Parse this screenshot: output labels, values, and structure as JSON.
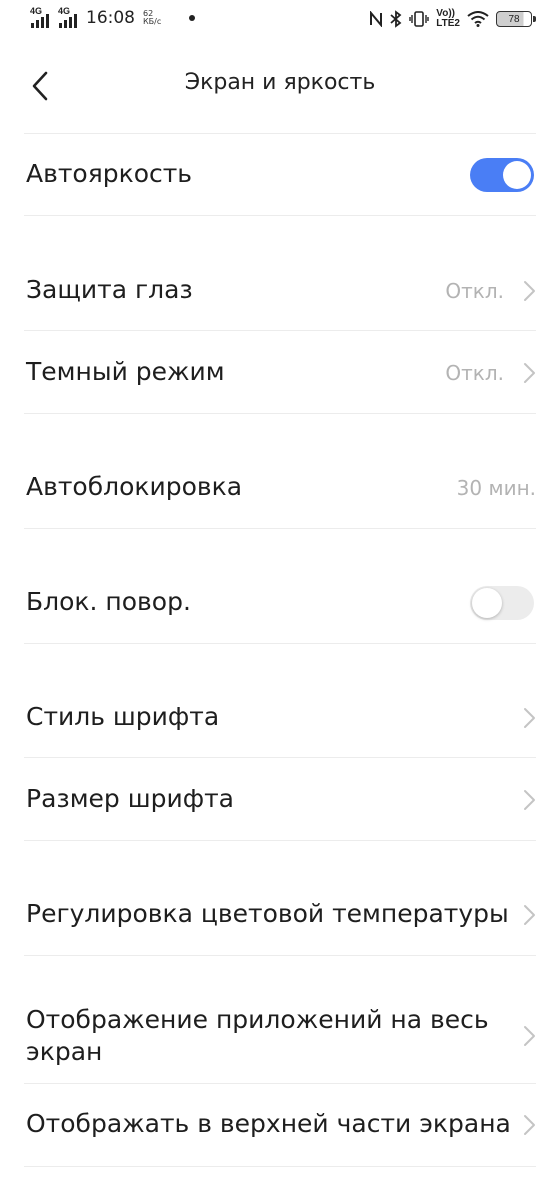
{
  "status_bar": {
    "sim1_tag": "4G",
    "sim2_tag": "4G",
    "time": "16:08",
    "speed_value": "62",
    "speed_unit": "КБ/с",
    "volte_top": "Vo))",
    "volte_bottom": "LTE2",
    "battery": "78"
  },
  "header": {
    "title": "Экран и яркость"
  },
  "rows": {
    "auto_brightness": {
      "label": "Автояркость",
      "toggle_on": true
    },
    "eye_protection": {
      "label": "Защита глаз",
      "value": "Откл."
    },
    "dark_mode": {
      "label": "Темный режим",
      "value": "Откл."
    },
    "auto_lock": {
      "label": "Автоблокировка",
      "value": "30 мин."
    },
    "rotation_lock": {
      "label": "Блок. повор.",
      "toggle_on": false
    },
    "font_style": {
      "label": "Стиль шрифта"
    },
    "font_size": {
      "label": "Размер шрифта"
    },
    "color_temp": {
      "label": "Регулировка цветовой температуры"
    },
    "fullscreen_apps": {
      "label_line1": "Отображение приложений на весь",
      "label_line2": "экран"
    },
    "top_display": {
      "label": "Отображать в верхней части экрана"
    }
  },
  "colors": {
    "accent": "#4a7ef5",
    "secondary_text": "#b3b3b3",
    "divider": "#ececec"
  }
}
